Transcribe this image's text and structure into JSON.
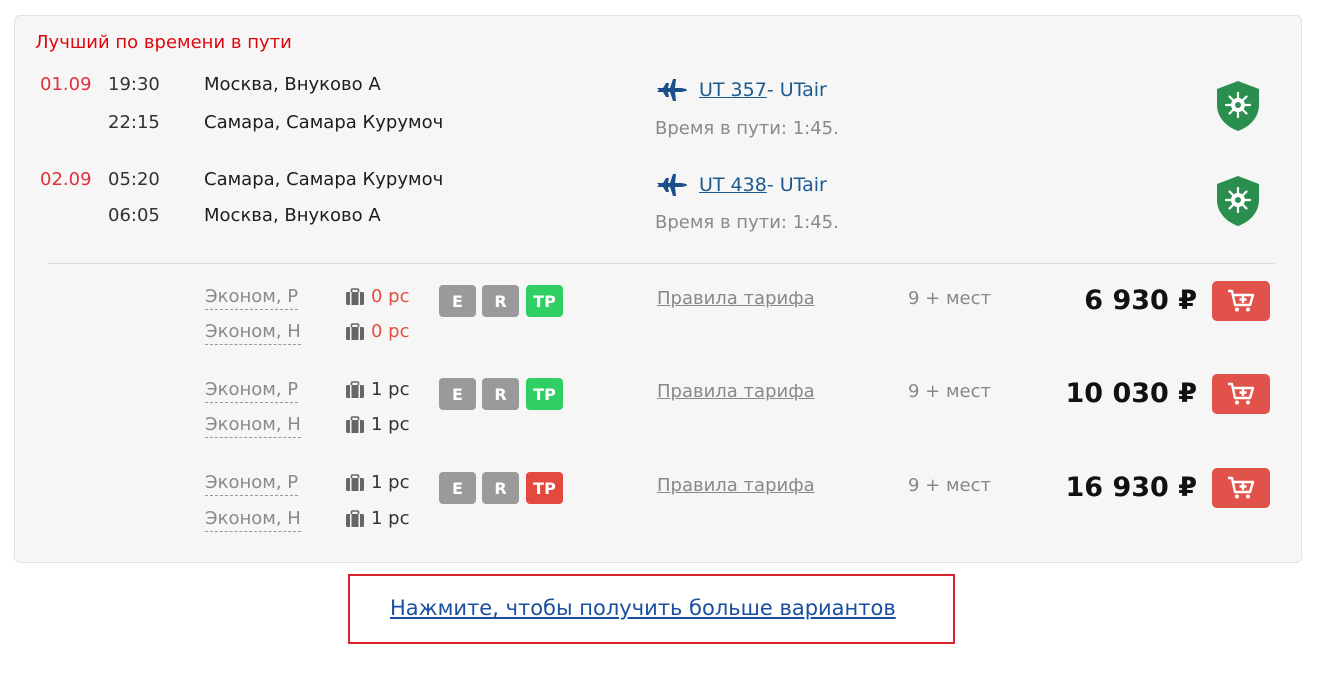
{
  "section_title": "Лучший по времени в пути",
  "segments": [
    {
      "date": "01.09",
      "dep_time": "19:30",
      "dep_place": "Москва, Внуково А",
      "arr_time": "22:15",
      "arr_place": "Самара, Самара Курумоч",
      "flight_number": "UT 357",
      "airline": " - UTair",
      "duration": "Время в пути: 1:45."
    },
    {
      "date": "02.09",
      "dep_time": "05:20",
      "dep_place": "Самара, Самара Курумоч",
      "arr_time": "06:05",
      "arr_place": "Москва, Внуково А",
      "flight_number": "UT 438",
      "airline": " - UTair",
      "duration": "Время в пути: 1:45."
    }
  ],
  "fares": [
    {
      "class1": "Эконом, Р",
      "baggage1": "0 pc",
      "class2": "Эконом, Н",
      "baggage2": "0 pc",
      "badges": [
        "E",
        "R",
        "TP"
      ],
      "tp_color": "green",
      "rules": "Правила тарифа",
      "seats": "9 + мест",
      "price": "6 930 ₽"
    },
    {
      "class1": "Эконом, Р",
      "baggage1": "1 pc",
      "class2": "Эконом, Н",
      "baggage2": "1 pc",
      "badges": [
        "E",
        "R",
        "TP"
      ],
      "tp_color": "green",
      "rules": "Правила тарифа",
      "seats": "9 + мест",
      "price": "10 030 ₽"
    },
    {
      "class1": "Эконом, Р",
      "baggage1": "1 pc",
      "class2": "Эконом, Н",
      "baggage2": "1 pc",
      "badges": [
        "E",
        "R",
        "TP"
      ],
      "tp_color": "red",
      "rules": "Правила тарифа",
      "seats": "9 + мест",
      "price": "16 930 ₽"
    }
  ],
  "more_link": "Нажмите, чтобы получить больше вариантов",
  "colors": {
    "accent_red": "#e0060f",
    "link_blue": "#1c5a8f",
    "cart_red": "#e0524a",
    "badge_green": "#2fcf63",
    "badge_red": "#e24a3f",
    "shield_green": "#2a8f4e"
  },
  "icons": {
    "plane": "plane-icon",
    "shield": "covid-shield-icon",
    "bag": "baggage-icon",
    "cart": "add-to-cart-icon"
  }
}
